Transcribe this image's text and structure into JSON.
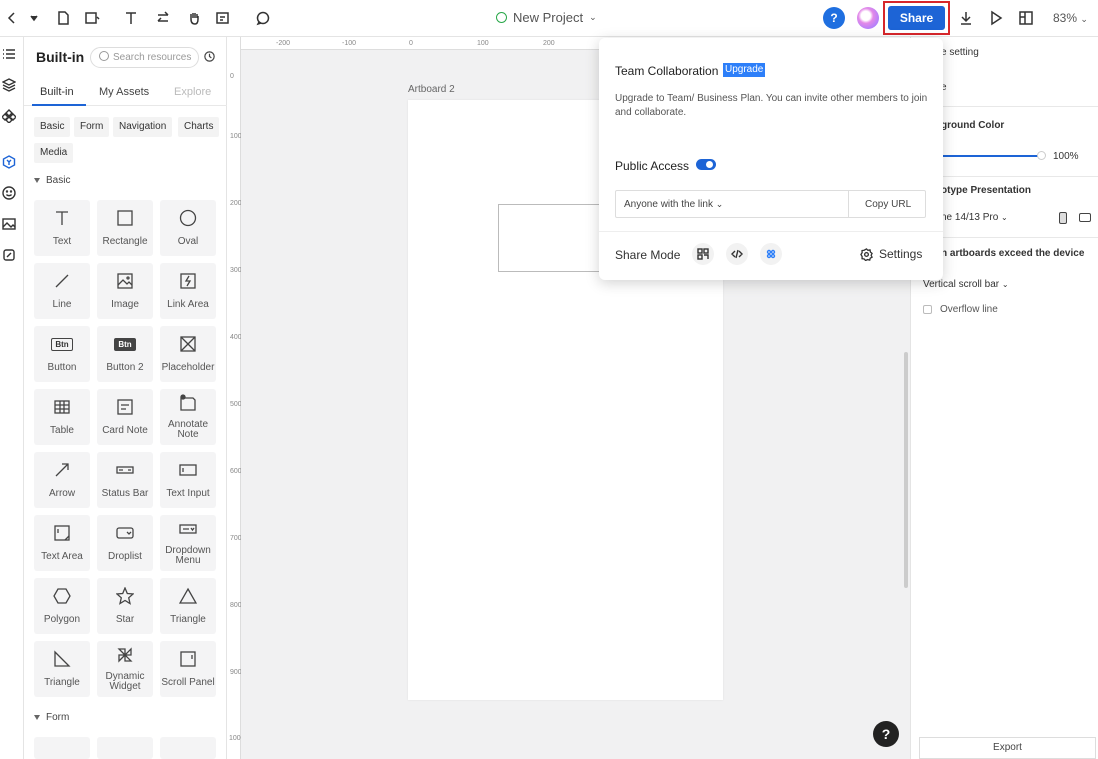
{
  "topbar": {
    "project_name": "New Project",
    "share_label": "Share",
    "help_label": "?",
    "zoom": "83%"
  },
  "left_panel": {
    "title": "Built-in",
    "search_placeholder": "Search resources",
    "tabs": [
      "Built-in",
      "My Assets",
      "Explore"
    ],
    "chips": [
      "Basic",
      "Form",
      "Navigation",
      "Charts",
      "Media"
    ],
    "section_basic": "Basic",
    "section_form": "Form",
    "tiles": [
      {
        "label": "Text",
        "icon": "text-icon"
      },
      {
        "label": "Rectangle",
        "icon": "rectangle-icon"
      },
      {
        "label": "Oval",
        "icon": "oval-icon"
      },
      {
        "label": "Line",
        "icon": "line-icon"
      },
      {
        "label": "Image",
        "icon": "image-icon"
      },
      {
        "label": "Link Area",
        "icon": "link-area-icon"
      },
      {
        "label": "Button",
        "icon": "button-icon"
      },
      {
        "label": "Button 2",
        "icon": "button2-icon"
      },
      {
        "label": "Placeholder",
        "icon": "placeholder-icon"
      },
      {
        "label": "Table",
        "icon": "table-icon"
      },
      {
        "label": "Card Note",
        "icon": "card-note-icon"
      },
      {
        "label": "Annotate Note",
        "icon": "annotate-note-icon"
      },
      {
        "label": "Arrow",
        "icon": "arrow-icon"
      },
      {
        "label": "Status Bar",
        "icon": "status-bar-icon"
      },
      {
        "label": "Text Input",
        "icon": "text-input-icon"
      },
      {
        "label": "Text Area",
        "icon": "text-area-icon"
      },
      {
        "label": "Droplist",
        "icon": "droplist-icon"
      },
      {
        "label": "Dropdown Menu",
        "icon": "dropdown-menu-icon"
      },
      {
        "label": "Polygon",
        "icon": "polygon-icon"
      },
      {
        "label": "Star",
        "icon": "star-icon"
      },
      {
        "label": "Triangle",
        "icon": "triangle-icon"
      },
      {
        "label": "Triangle",
        "icon": "right-triangle-icon"
      },
      {
        "label": "Dynamic Widget",
        "icon": "dynamic-widget-icon"
      },
      {
        "label": "Scroll Panel",
        "icon": "scroll-panel-icon"
      }
    ],
    "button_glyph": "Btn"
  },
  "canvas": {
    "artboard_label": "Artboard 2",
    "ruler_h": [
      "-200",
      "-100",
      "0",
      "100",
      "200"
    ],
    "ruler_v": [
      "0",
      "100",
      "200",
      "300",
      "400",
      "500",
      "600",
      "700",
      "800",
      "900",
      "1000"
    ],
    "help_label": "?"
  },
  "right_panel": {
    "page_setting": "e setting",
    "page_field": "e",
    "bg_color_label": "ground Color",
    "opacity": "100%",
    "proto_label": "otype Presentation",
    "device": "ne 14/13 Pro",
    "exceed_label": "n artboards exceed the device",
    "scroll_option": "Vertical scroll bar",
    "overflow_label": "Overflow line",
    "export_label": "Export"
  },
  "share_popup": {
    "title": "Team Collaboration",
    "upgrade_tag": "Upgrade",
    "description": "Upgrade to Team/ Business Plan. You can invite other members to join and collaborate.",
    "public_access_label": "Public Access",
    "public_access_on": true,
    "link_option": "Anyone with the link",
    "copy_url_label": "Copy URL",
    "share_mode_label": "Share Mode",
    "settings_label": "Settings"
  },
  "colors": {
    "accent": "#1d64d6",
    "highlight_border": "#d7262b",
    "upgrade_tag": "#2d7ff9"
  }
}
